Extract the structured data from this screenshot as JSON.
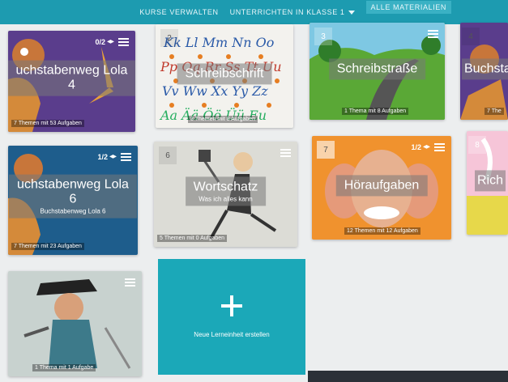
{
  "nav": {
    "items": [
      {
        "label": "KURSE VERWALTEN"
      },
      {
        "label": "UNTERRICHTEN IN KLASSE 1"
      },
      {
        "label": "ALLE MATERIALIEN"
      }
    ]
  },
  "cards": [
    {
      "num": "",
      "progress": "0/2",
      "title": "uchstabenweg Lola",
      "subtitle": "4",
      "footer": "7 Themen mit 53 Aufgaben"
    },
    {
      "num": "2",
      "progress": "",
      "title": "Schreibschrift",
      "subtitle": "",
      "footer": "3 Themen mit 8 Aufgaben"
    },
    {
      "num": "3",
      "progress": "",
      "title": "Schreibstraße",
      "subtitle": "",
      "footer": "1 Thema mit 8 Aufgaben"
    },
    {
      "num": "4",
      "progress": "",
      "title": "Buchsta",
      "subtitle": "",
      "footer": "7 The"
    },
    {
      "num": "",
      "progress": "1/2",
      "title": "uchstabenweg Lola",
      "subtitle": "6",
      "extra": "Buchstabenweg Lola 6",
      "footer": "7 Themen mit 23 Aufgaben"
    },
    {
      "num": "6",
      "progress": "",
      "title": "Wortschatz",
      "subtitle": "Was ich alles kann",
      "footer": "5 Themen mit 0 Aufgaben"
    },
    {
      "num": "7",
      "progress": "1/2",
      "title": "Höraufgaben",
      "subtitle": "",
      "footer": "12 Themen mit 12 Aufgaben"
    },
    {
      "num": "8",
      "progress": "",
      "title": "Rich",
      "subtitle": "",
      "footer": ""
    },
    {
      "num": "",
      "progress": "",
      "title": "",
      "subtitle": "",
      "footer": "1 Thema mit 1 Aufgabe"
    }
  ],
  "add_card": {
    "label": "Neue Lerneinheit erstellen"
  },
  "colors": {
    "teal": "#1d9bb0",
    "purple": "#5a3d8c",
    "blue": "#1e5d8c",
    "orange": "#f0922e"
  }
}
